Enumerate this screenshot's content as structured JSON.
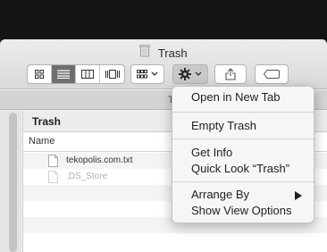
{
  "window": {
    "title": "Trash"
  },
  "toolbar": {
    "view_buttons": [
      "icon-view",
      "list-view",
      "column-view",
      "gallery-view"
    ],
    "active_view": "list-view"
  },
  "tab": {
    "label_fragment": "T"
  },
  "path_bar": {
    "label": "Trash"
  },
  "columns": {
    "name": "Name"
  },
  "files": [
    {
      "name": "tekopolis.com.txt",
      "hidden": false
    },
    {
      "name": ".DS_Store",
      "hidden": true
    }
  ],
  "action_menu": {
    "items": {
      "open_new_tab": "Open in New Tab",
      "empty_trash": "Empty Trash",
      "get_info": "Get Info",
      "quick_look": "Quick Look “Trash”",
      "arrange_by": "Arrange By",
      "show_view_options": "Show View Options"
    }
  },
  "colors": {
    "active_segment": "#6e6e6e",
    "menu_bg": "#f6f6f6"
  }
}
